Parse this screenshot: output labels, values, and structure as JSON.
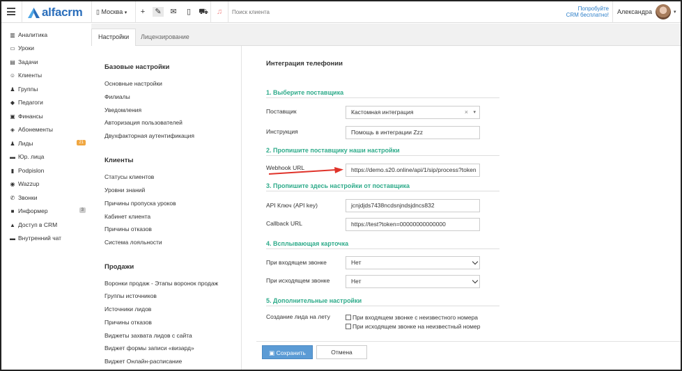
{
  "header": {
    "logo_text": "alfacrm",
    "city": "Москва",
    "search_placeholder": "Поиск клиента",
    "promo_line1": "Попробуйте",
    "promo_line2": "CRM бесплатно!",
    "username": "Александра",
    "icons": [
      "menu-icon",
      "building-icon",
      "plus-icon",
      "wrench-icon",
      "mail-icon",
      "phone-icon",
      "cart-icon",
      "bell-icon"
    ]
  },
  "sidebar": {
    "items": [
      {
        "label": "Аналитика",
        "icon": "▥"
      },
      {
        "label": "Уроки",
        "icon": "▭"
      },
      {
        "label": "Задачи",
        "icon": "▤"
      },
      {
        "label": "Клиенты",
        "icon": "☺"
      },
      {
        "label": "Группы",
        "icon": "♟"
      },
      {
        "label": "Педагоги",
        "icon": "◆"
      },
      {
        "label": "Финансы",
        "icon": "▣"
      },
      {
        "label": "Абонементы",
        "icon": "◈"
      },
      {
        "label": "Лиды",
        "icon": "♟",
        "badge": "21"
      },
      {
        "label": "Юр. лица",
        "icon": "▬"
      },
      {
        "label": "Podpislon",
        "icon": "▮"
      },
      {
        "label": "Wazzup",
        "icon": "◉"
      },
      {
        "label": "Звонки",
        "icon": "✆"
      },
      {
        "label": "Информер",
        "icon": "■",
        "badge": "3"
      },
      {
        "label": "Доступ в CRM",
        "icon": "▲"
      },
      {
        "label": "Внутренний чат",
        "icon": "▬"
      }
    ]
  },
  "tabs": [
    {
      "label": "Настройки"
    },
    {
      "label": "Лицензирование"
    }
  ],
  "menu": {
    "sections": [
      {
        "title": "Базовые настройки",
        "items": [
          "Основные настройки",
          "Филиалы",
          "Уведомления",
          "Авторизация пользователей",
          "Двухфакторная аутентификация"
        ]
      },
      {
        "title": "Клиенты",
        "items": [
          "Статусы клиентов",
          "Уровни знаний",
          "Причины пропуска уроков",
          "Кабинет клиента",
          "Причины отказов",
          "Система лояльности"
        ]
      },
      {
        "title": "Продажи",
        "items": [
          "Воронки продаж - Этапы воронок продаж",
          "Группы источников",
          "Источники лидов",
          "Причины отказов",
          "Виджеты захвата лидов с сайта",
          "Виджет формы записи «визард»",
          "Виджет Онлайн-расписание"
        ]
      }
    ]
  },
  "pane": {
    "title": "Интеграция телефонии",
    "section1": "1. Выберите поставщика",
    "provider_label": "Поставщик",
    "provider_value": "Кастомная интеграция",
    "instruction_label": "Инструкция",
    "instruction_value": "Помощь в интеграции Zzz",
    "section2": "2. Пропишите поставщику наши настройки",
    "webhook_label": "Webhook URL",
    "webhook_value": "https://demo.s20.online/api/1/sip/process?token",
    "section3": "3. Пропишите здесь настройки от поставщика",
    "apikey_label": "API Ключ (API key)",
    "apikey_value": "jcnjdjds7438ncdsnjndsjdncs832",
    "callback_label": "Callback URL",
    "callback_value": "https://test?token=00000000000000",
    "section4": "4. Всплывающая карточка",
    "incoming_label": "При входящем звонке",
    "incoming_value": "Нет",
    "outgoing_label": "При исходящем звонке",
    "outgoing_value": "Нет",
    "section5": "5. Дополнительные настройки",
    "lead_label": "Создание лида на лету",
    "chk1": "При входящем звонке с неизвестного номера",
    "chk2": "При исходящем звонке на неизвестный номер",
    "save": "Сохранить",
    "cancel": "Отмена"
  },
  "colors": {
    "accent": "#2eab8a",
    "primary_btn": "#5b9bd5",
    "arrow": "#e0332a",
    "badge_orange": "#f0a640"
  }
}
